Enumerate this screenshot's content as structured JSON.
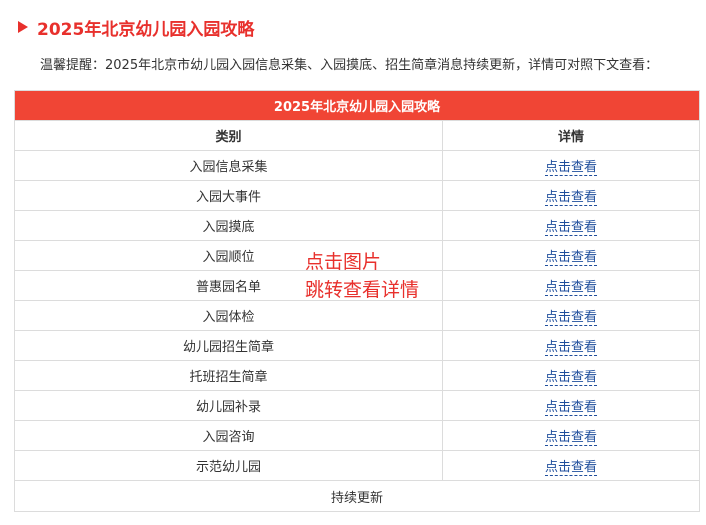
{
  "heading": {
    "title": "2025年北京幼儿园入园攻略",
    "accent_color": "#e8302c",
    "icon": "triangle-right-icon"
  },
  "notice": "温馨提醒：2025年北京市幼儿园入园信息采集、入园摸底、招生简章消息持续更新，详情可对照下文查看：",
  "table": {
    "caption": "2025年北京幼儿园入园攻略",
    "caption_color": "#f04535",
    "columns": [
      "类别",
      "详情"
    ],
    "rows": [
      {
        "category": "入园信息采集",
        "link": "点击查看"
      },
      {
        "category": "入园大事件",
        "link": "点击查看"
      },
      {
        "category": "入园摸底",
        "link": "点击查看"
      },
      {
        "category": "入园顺位",
        "link": "点击查看"
      },
      {
        "category": "普惠园名单",
        "link": "点击查看"
      },
      {
        "category": "入园体检",
        "link": "点击查看"
      },
      {
        "category": "幼儿园招生简章",
        "link": "点击查看"
      },
      {
        "category": "托班招生简章",
        "link": "点击查看"
      },
      {
        "category": "幼儿园补录",
        "link": "点击查看"
      },
      {
        "category": "入园咨询",
        "link": "点击查看"
      },
      {
        "category": "示范幼儿园",
        "link": "点击查看"
      }
    ],
    "footer": "持续更新"
  },
  "overlay": {
    "line1": "点击图片",
    "line2": "跳转查看详情"
  }
}
